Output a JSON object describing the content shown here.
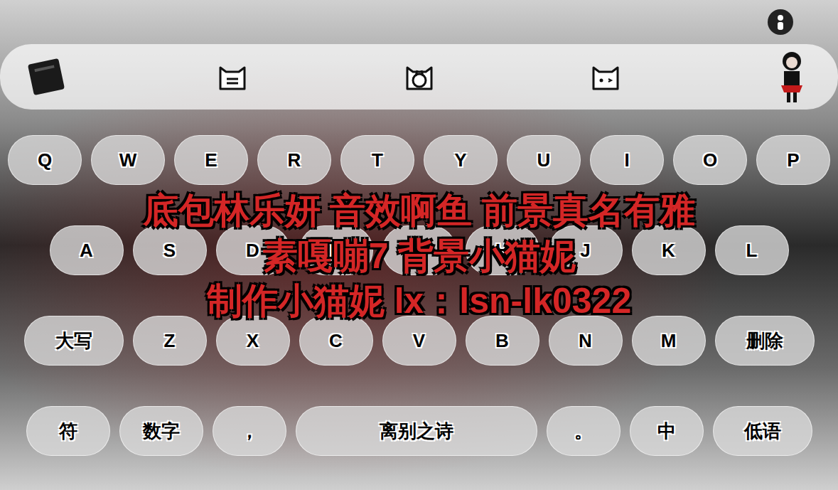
{
  "toolbar": {
    "icon_count": 5
  },
  "keyboard": {
    "rows": [
      [
        {
          "label": "Q",
          "kind": "letter"
        },
        {
          "label": "W",
          "kind": "letter"
        },
        {
          "label": "E",
          "kind": "letter"
        },
        {
          "label": "R",
          "kind": "letter"
        },
        {
          "label": "T",
          "kind": "letter"
        },
        {
          "label": "Y",
          "kind": "letter"
        },
        {
          "label": "U",
          "kind": "letter"
        },
        {
          "label": "I",
          "kind": "letter"
        },
        {
          "label": "O",
          "kind": "letter"
        },
        {
          "label": "P",
          "kind": "letter"
        }
      ],
      [
        {
          "label": "A",
          "kind": "letter"
        },
        {
          "label": "S",
          "kind": "letter"
        },
        {
          "label": "D",
          "kind": "letter"
        },
        {
          "label": "F",
          "kind": "letter"
        },
        {
          "label": "G",
          "kind": "letter"
        },
        {
          "label": "H",
          "kind": "letter"
        },
        {
          "label": "J",
          "kind": "letter"
        },
        {
          "label": "K",
          "kind": "letter"
        },
        {
          "label": "L",
          "kind": "letter"
        }
      ],
      [
        {
          "label": "大写",
          "kind": "function"
        },
        {
          "label": "Z",
          "kind": "letter"
        },
        {
          "label": "X",
          "kind": "letter"
        },
        {
          "label": "C",
          "kind": "letter"
        },
        {
          "label": "V",
          "kind": "letter"
        },
        {
          "label": "B",
          "kind": "letter"
        },
        {
          "label": "N",
          "kind": "letter"
        },
        {
          "label": "M",
          "kind": "letter"
        },
        {
          "label": "删除",
          "kind": "function"
        }
      ],
      [
        {
          "label": "符",
          "kind": "mid"
        },
        {
          "label": "数字",
          "kind": "mid"
        },
        {
          "label": "，",
          "kind": "letter"
        },
        {
          "label": "离别之诗",
          "kind": "space"
        },
        {
          "label": "。",
          "kind": "letter"
        },
        {
          "label": "中",
          "kind": "letter"
        },
        {
          "label": "低语",
          "kind": "function"
        }
      ]
    ]
  },
  "credits": [
    "底包林乐妍 音效啊鱼 前景真名有雅",
    "素嘎嘣7 背景小猫妮",
    "制作小猫妮 lx：lsn-lk0322"
  ]
}
